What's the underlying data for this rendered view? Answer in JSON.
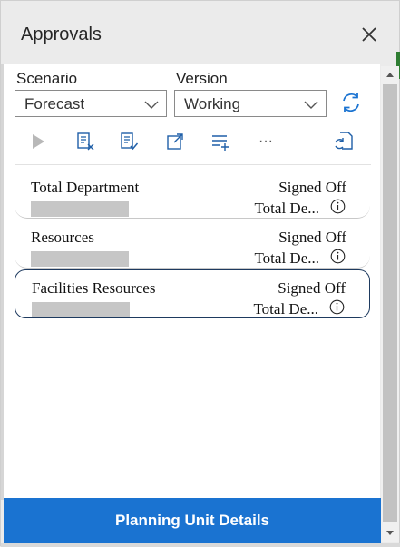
{
  "header": {
    "title": "Approvals"
  },
  "filters": {
    "scenario_label": "Scenario",
    "scenario_value": "Forecast",
    "version_label": "Version",
    "version_value": "Working"
  },
  "toolbar": {
    "icons": [
      "play-icon",
      "reject-icon",
      "approve-icon",
      "open-icon",
      "add-list-icon",
      "more-icon",
      "refresh-doc-icon"
    ],
    "more_label": "···"
  },
  "items": [
    {
      "name": "Total Department",
      "status": "Signed Off",
      "owner": "Total De...",
      "selected": false
    },
    {
      "name": "Resources",
      "status": "Signed Off",
      "owner": "Total De...",
      "selected": false
    },
    {
      "name": "Facilities Resources",
      "status": "Signed Off",
      "owner": "Total De...",
      "selected": true
    }
  ],
  "footer": {
    "button_label": "Planning Unit Details"
  },
  "colors": {
    "accent": "#1a73d1",
    "selected_border": "#1e3a5f",
    "refresh_icon": "#1a73d1",
    "toolbar_icon": "#1f5fa8"
  }
}
